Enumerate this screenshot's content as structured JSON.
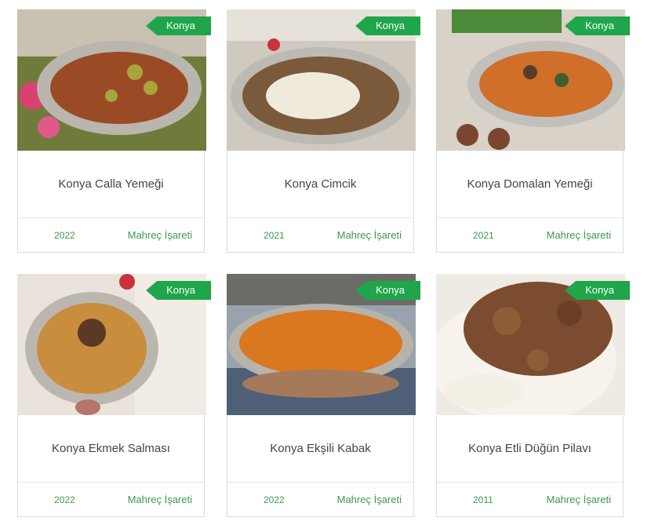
{
  "cards": [
    {
      "badge": "Konya",
      "title": "Konya Calla Yemeği",
      "year": "2022",
      "link": "Mahreç İşareti"
    },
    {
      "badge": "Konya",
      "title": "Konya Cimcik",
      "year": "2021",
      "link": "Mahreç İşareti"
    },
    {
      "badge": "Konya",
      "title": "Konya Domalan Yemeği",
      "year": "2021",
      "link": "Mahreç İşareti"
    },
    {
      "badge": "Konya",
      "title": "Konya Ekmek Salması",
      "year": "2022",
      "link": "Mahreç İşareti"
    },
    {
      "badge": "Konya",
      "title": "Konya Ekşili Kabak",
      "year": "2022",
      "link": "Mahreç İşareti"
    },
    {
      "badge": "Konya",
      "title": "Konya Etli Düğün Pilavı",
      "year": "2011",
      "link": "Mahreç İşareti"
    }
  ],
  "colors": {
    "badge": "#1fa64a",
    "accent": "#3a9a4f",
    "border": "#dcdcdc"
  }
}
